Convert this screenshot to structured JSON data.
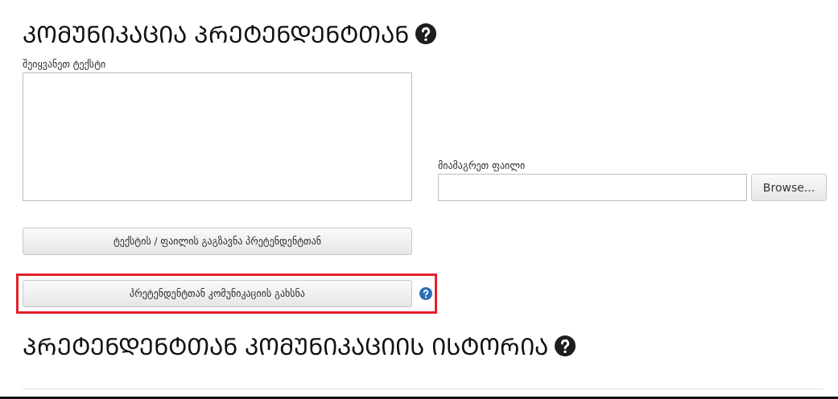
{
  "title": {
    "text": "ᲙᲝᲛᲣᲜᲘᲙᲐᲪᲘᲐ ᲞᲠᲔᲢᲔᲜᲓᲔᲜᲢᲗᲐᲜ",
    "help": true
  },
  "message": {
    "label": "შეიყვანეთ ტექსტი"
  },
  "attachment": {
    "label": "მიამაგრეთ ფაილი",
    "button": "Browse..."
  },
  "send_button": {
    "label": "ტექსტის / ფაილის გაგზავნა პრეტენდენტთან"
  },
  "open_button": {
    "label": "პრეტენდენტთან კომუნიკაციის გახსნა",
    "highlighted": true,
    "help": true
  },
  "history": {
    "text": "ᲞᲠᲔᲢᲔᲜᲓᲔᲜᲢᲗᲐᲜ ᲙᲝᲛᲣᲜᲘᲙᲐᲪᲘᲘᲡ ᲘᲡᲢᲝᲠᲘᲐ",
    "help": true
  }
}
